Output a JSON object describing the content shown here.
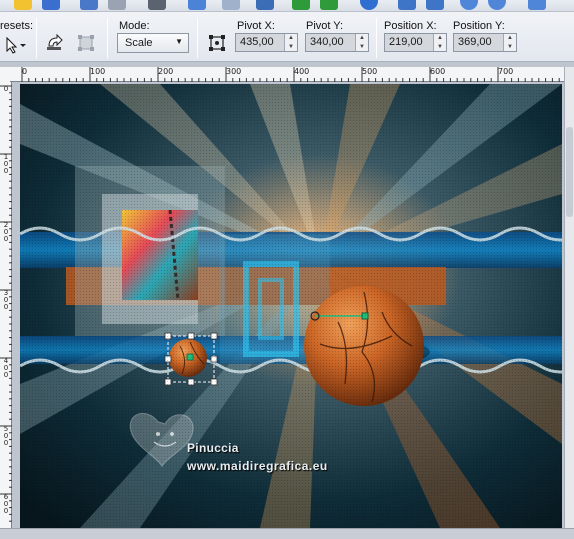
{
  "toolbar": {
    "presets_label": "resets:",
    "mode_label": "Mode:",
    "mode_value": "Scale",
    "pivot_x_label": "Pivot X:",
    "pivot_x_value": "435,00",
    "pivot_y_label": "Pivot Y:",
    "pivot_y_value": "340,00",
    "position_x_label": "Position X:",
    "position_x_value": "219,00",
    "position_y_label": "Position Y:",
    "position_y_value": "369,00"
  },
  "ruler": {
    "h_labels": [
      "0",
      "100",
      "200",
      "300",
      "400",
      "500",
      "600",
      "700"
    ],
    "v_labels": [
      "0",
      "100",
      "200",
      "300",
      "400",
      "500",
      "600"
    ]
  },
  "watermark": {
    "name": "Pinuccia",
    "url": "www.maidiregrafica.eu"
  },
  "colors": {
    "canvas_bg": "#0c2a36",
    "orange": "#c4581a",
    "selection_node": "#1fbf7a"
  }
}
